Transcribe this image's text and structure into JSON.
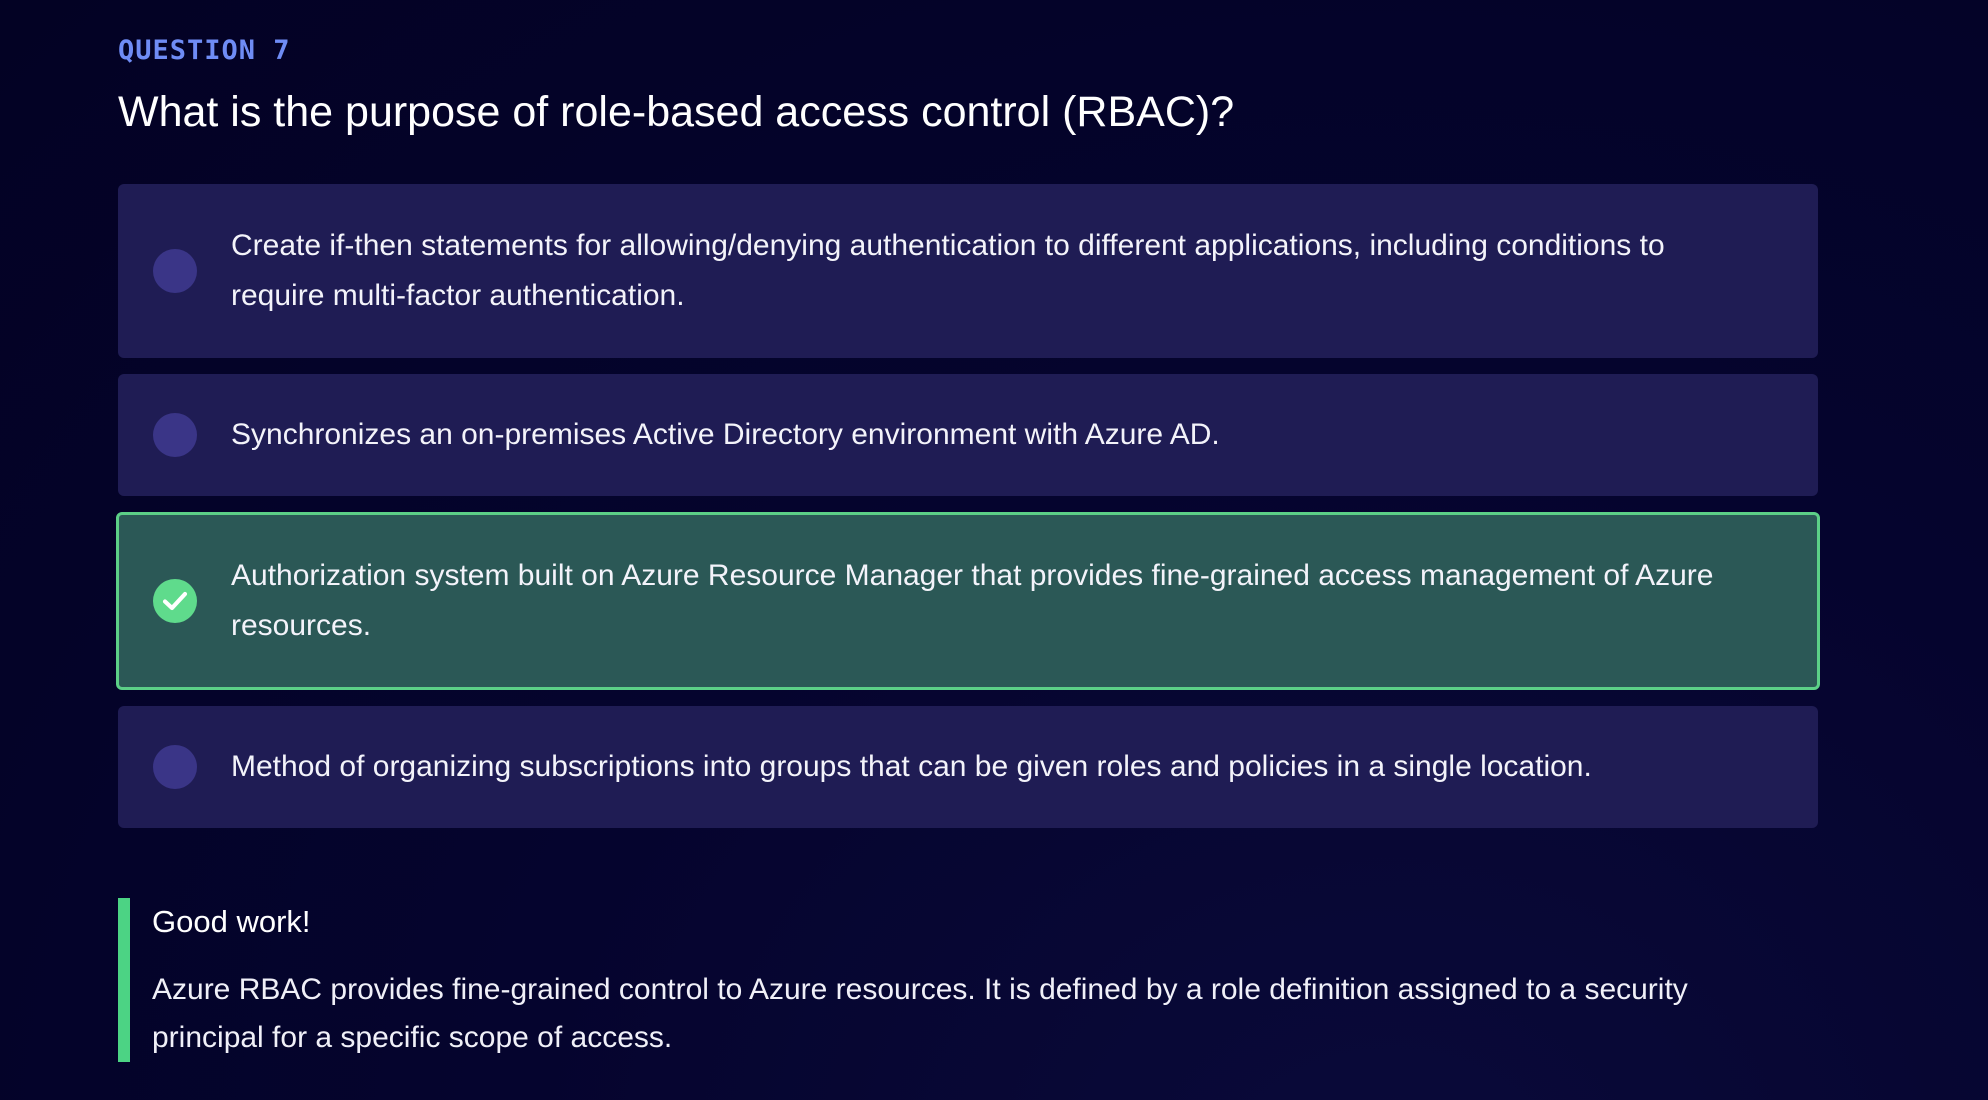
{
  "question": {
    "label": "QUESTION 7",
    "text": "What is the purpose of role-based access control (RBAC)?"
  },
  "options": [
    {
      "text": "Create if-then statements for allowing/denying authentication to different applications, including conditions to require multi-factor authentication.",
      "selected": false,
      "correct": false
    },
    {
      "text": "Synchronizes an on-premises Active Directory environment with Azure AD.",
      "selected": false,
      "correct": false
    },
    {
      "text": "Authorization system built on Azure Resource Manager that provides fine-grained access management of Azure resources.",
      "selected": true,
      "correct": true
    },
    {
      "text": "Method of organizing subscriptions into groups that can be given roles and policies in a single location.",
      "selected": false,
      "correct": false
    }
  ],
  "feedback": {
    "title": "Good work!",
    "text": "Azure RBAC provides fine-grained control to Azure resources. It is defined by a role definition assigned to a security principal for a specific scope of access."
  },
  "colors": {
    "background": "#05042e",
    "accent_label": "#6f8cf5",
    "option_bg": "#1f1c54",
    "radio_bg": "#3a3587",
    "correct_bg": "#2b5856",
    "correct_border": "#5ccf87",
    "feedback_bar": "#4cd384"
  },
  "icons": {
    "check": "check-circle-icon"
  }
}
